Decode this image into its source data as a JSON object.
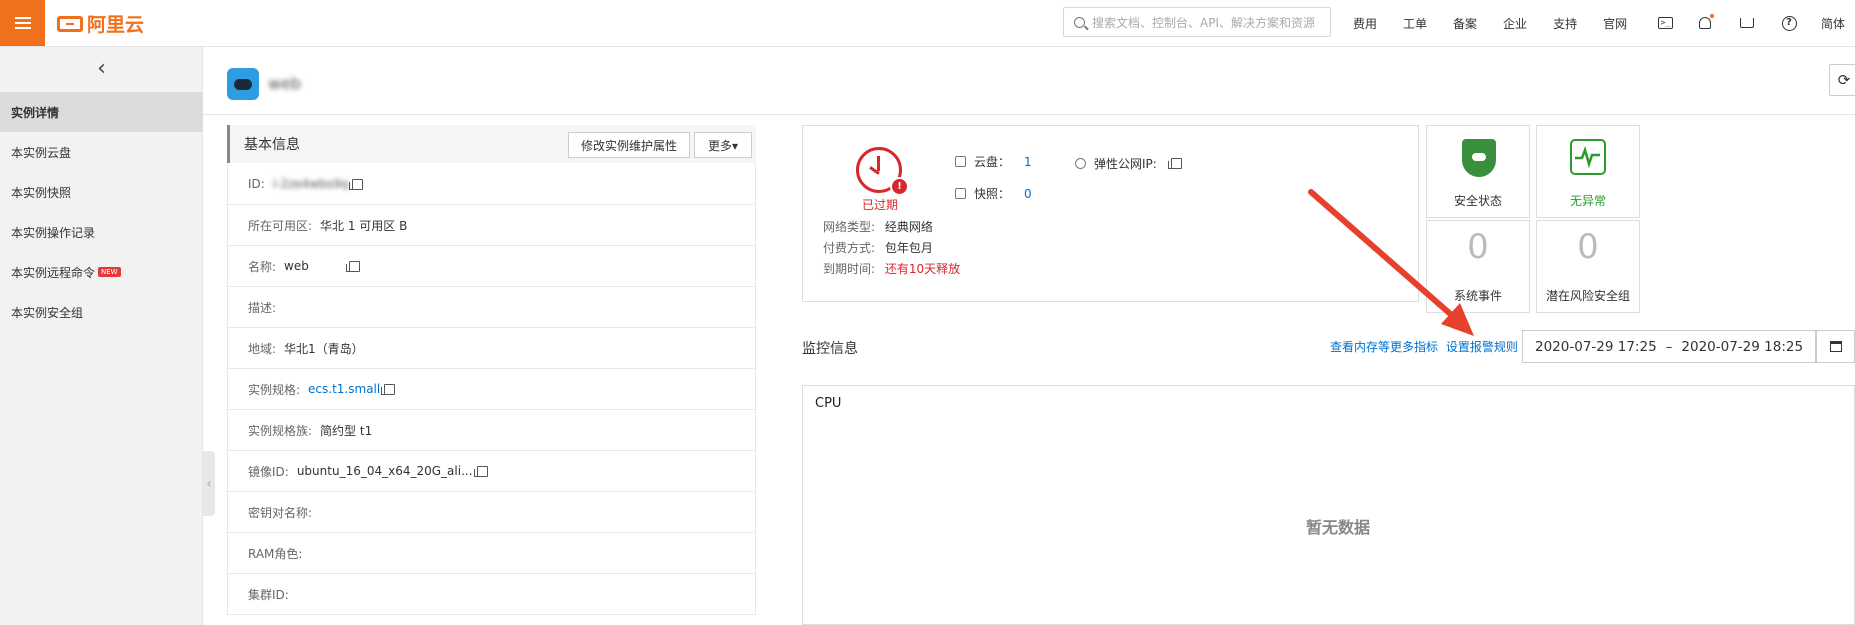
{
  "topbar": {
    "brand": "阿里云",
    "search_placeholder": "搜索文档、控制台、API、解决方案和资源",
    "links": [
      "费用",
      "工单",
      "备案",
      "企业",
      "支持",
      "官网"
    ],
    "lang": "简体",
    "colors": {
      "brand": "#f0701e"
    }
  },
  "sidebar": {
    "collapse_glyph": "‹",
    "items": [
      {
        "label": "实例详情",
        "active": true
      },
      {
        "label": "本实例云盘"
      },
      {
        "label": "本实例快照"
      },
      {
        "label": "本实例操作记录"
      },
      {
        "label": "本实例远程命令",
        "badge": "NEW"
      },
      {
        "label": "本实例安全组"
      }
    ]
  },
  "header": {
    "instance_name": "web"
  },
  "basic_info": {
    "title": "基本信息",
    "edit_button": "修改实例维护属性",
    "more_button": "更多▾",
    "rows": [
      {
        "label": "ID:",
        "value": "i-2ze4wbs9q"
      },
      {
        "label": "所在可用区:",
        "value": "华北 1 可用区 B"
      },
      {
        "label": "名称:",
        "value": "web"
      },
      {
        "label": "描述:",
        "value": ""
      },
      {
        "label": "地域:",
        "value": "华北1（青岛）"
      },
      {
        "label": "实例规格:",
        "value": "ecs.t1.small"
      },
      {
        "label": "实例规格族:",
        "value": "简约型 t1"
      },
      {
        "label": "镜像ID:",
        "value": "ubuntu_16_04_x64_20G_ali..."
      },
      {
        "label": "密钥对名称:",
        "value": ""
      },
      {
        "label": "RAM角色:",
        "value": ""
      },
      {
        "label": "集群ID:",
        "value": ""
      }
    ]
  },
  "status": {
    "state": "已过期",
    "disk_label": "云盘：",
    "disk_count": "1",
    "snapshot_label": "快照：",
    "snapshot_count": "0",
    "eip_label": "弹性公网IP:",
    "network_label": "网络类型:",
    "network_value": "经典网络",
    "pay_label": "付费方式:",
    "pay_value": "包年包月",
    "expire_label": "到期时间:",
    "expire_value": "还有10天释放",
    "alert_color": "#d9262c"
  },
  "tiles": {
    "security_status": "安全状态",
    "no_anomaly": "无异常",
    "system_events_count": "0",
    "system_events": "系统事件",
    "risk_groups_count": "0",
    "risk_groups": "潜在风险安全组"
  },
  "monitor": {
    "title": "监控信息",
    "link_more": "查看内存等更多指标",
    "link_alarm": "设置报警规则",
    "date_start": "2020-07-29 17:25",
    "date_sep": "–",
    "date_end": "2020-07-29 18:25",
    "cpu_title": "CPU",
    "no_data": "暂无数据"
  }
}
